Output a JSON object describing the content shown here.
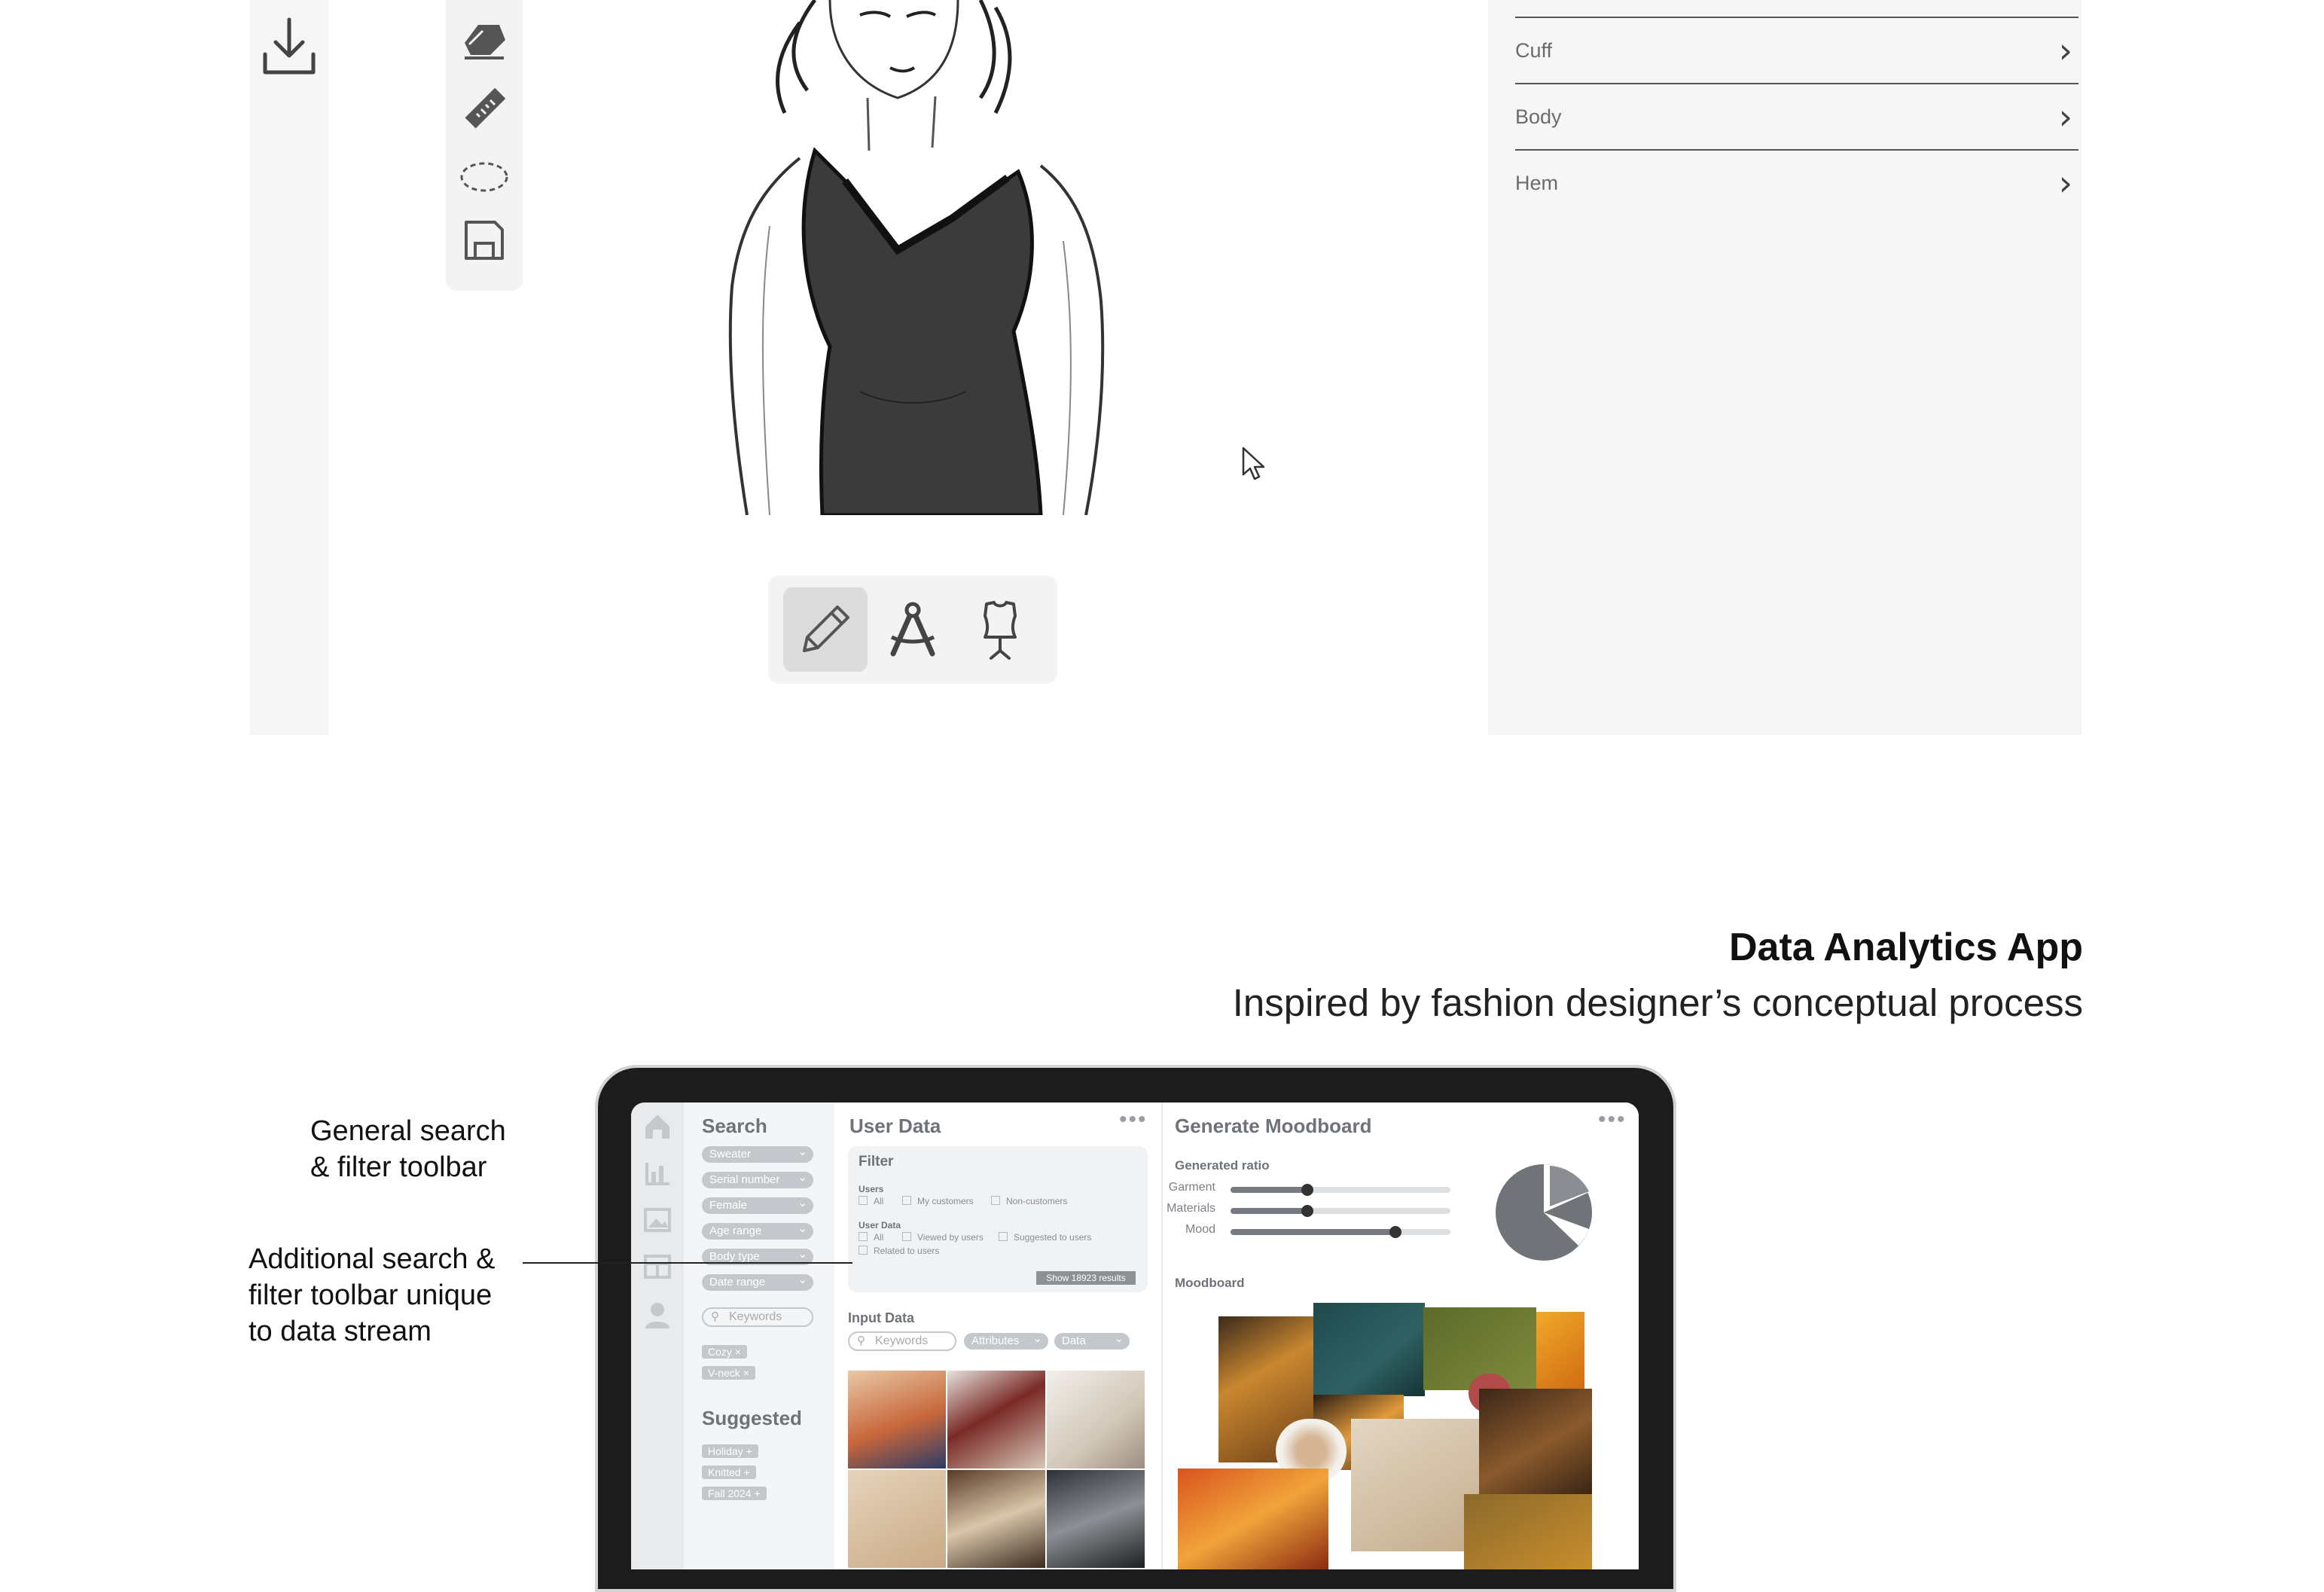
{
  "top_app": {
    "right_panel_items": [
      {
        "label": "Cuff"
      },
      {
        "label": "Body"
      },
      {
        "label": "Hem"
      }
    ]
  },
  "section": {
    "title": "Data Analytics App",
    "subtitle": "Inspired by fashion designer’s conceptual process"
  },
  "annotations": {
    "general_toolbar": [
      "General search",
      "& filter toolbar"
    ],
    "additional_toolbar": [
      "Additional search &",
      "filter toolbar unique",
      "to data stream"
    ]
  },
  "laptop": {
    "search_panel": {
      "title": "Search",
      "filters": [
        "Sweater",
        "Serial number",
        "Female",
        "Age range",
        "Body type",
        "Date range"
      ],
      "keywords_placeholder": "Keywords",
      "tags": [
        "Cozy ×",
        "V-neck ×"
      ],
      "suggested_title": "Suggested",
      "suggested_tags": [
        "Holiday +",
        "Knitted +",
        "Fall 2024 +"
      ]
    },
    "user_data": {
      "title": "User Data",
      "more": "•••",
      "filter_title": "Filter",
      "users_label": "Users",
      "users_options": [
        "All",
        "My customers",
        "Non-customers"
      ],
      "user_data_label": "User Data",
      "user_data_options": [
        "All",
        "Viewed by users",
        "Suggested to users",
        "Related to users"
      ],
      "show_button": "Show 18923 results",
      "input_data_title": "Input Data",
      "input_keywords": "Keywords",
      "input_attributes": "Attributes",
      "input_data": "Data"
    },
    "moodboard": {
      "title": "Generate Moodboard",
      "more": "•••",
      "ratio_title": "Generated ratio",
      "sliders": [
        {
          "label": "Garment",
          "value": 0.35
        },
        {
          "label": "Materials",
          "value": 0.35
        },
        {
          "label": "Mood",
          "value": 0.75
        }
      ],
      "moodboard_label": "Moodboard"
    }
  },
  "colors": {
    "panel_bg": "#f6f6f6",
    "dress_fill": "#3b3b3b",
    "laptop_bezel": "#1c1c1c",
    "pill_gray": "#c4c7cb"
  }
}
